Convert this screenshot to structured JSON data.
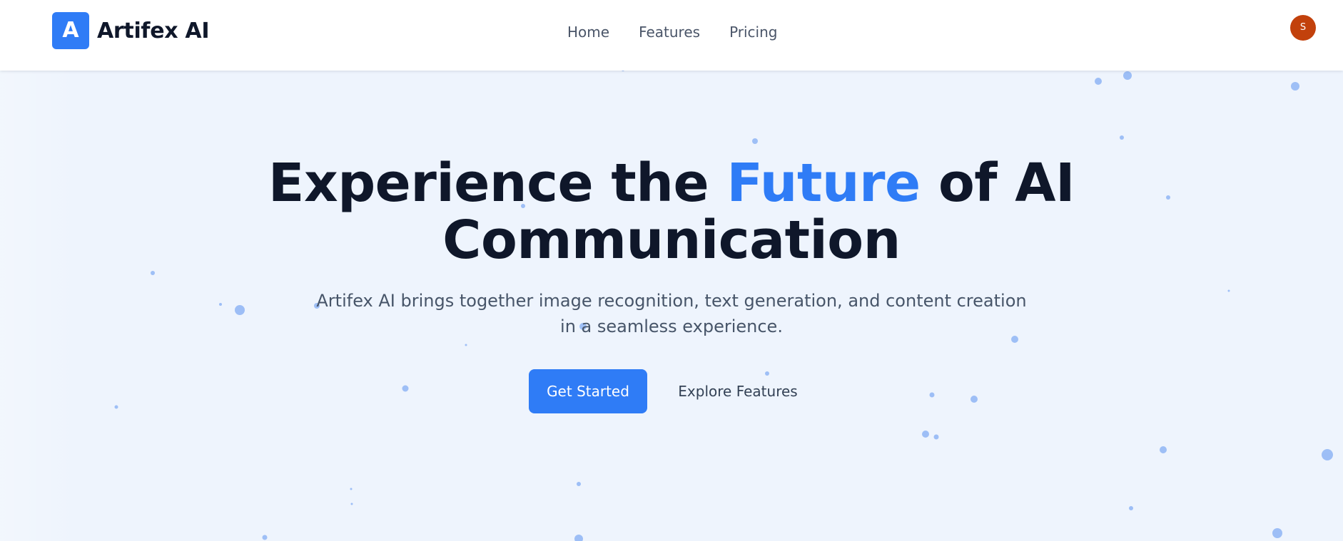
{
  "brand": {
    "logo_letter": "A",
    "name": "Artifex AI",
    "accent_color": "#2f7cf6"
  },
  "nav": {
    "links": [
      "Home",
      "Features",
      "Pricing"
    ]
  },
  "user": {
    "avatar_initial": "S",
    "avatar_color": "#c2410c"
  },
  "hero": {
    "title_prefix": "Experience the ",
    "title_accent": "Future",
    "title_suffix": " of AI Communication",
    "subtitle": "Artifex AI brings together image recognition, text generation, and content creation in a seamless experience.",
    "primary_cta": "Get Started",
    "secondary_cta": "Explore Features",
    "background_color": "#eef4fd",
    "particle_color": "#8fb5f5"
  }
}
